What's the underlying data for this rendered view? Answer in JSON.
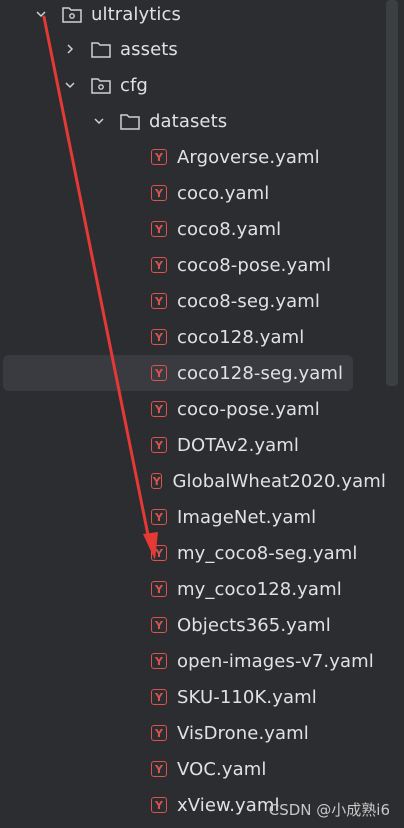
{
  "tree": {
    "root": {
      "label": "ultralytics",
      "expanded": true
    },
    "assets": {
      "label": "assets",
      "expanded": false
    },
    "cfg": {
      "label": "cfg",
      "expanded": true
    },
    "datasets": {
      "label": "datasets",
      "expanded": true
    },
    "files": [
      "Argoverse.yaml",
      "coco.yaml",
      "coco8.yaml",
      "coco8-pose.yaml",
      "coco8-seg.yaml",
      "coco128.yaml",
      "coco128-seg.yaml",
      "coco-pose.yaml",
      "DOTAv2.yaml",
      "GlobalWheat2020.yaml",
      "ImageNet.yaml",
      "my_coco8-seg.yaml",
      "my_coco128.yaml",
      "Objects365.yaml",
      "open-images-v7.yaml",
      "SKU-110K.yaml",
      "VisDrone.yaml",
      "VOC.yaml",
      "xView.yaml"
    ],
    "selected_file": "coco128-seg.yaml",
    "yaml_icon_glyph": "Y"
  },
  "watermark": "CSDN @小成熟i6",
  "colors": {
    "background": "#2b2d30",
    "selection": "#393b40",
    "text": "#dfe1e5",
    "yaml_icon": "#d9534f",
    "annotation_arrow": "#e53935"
  }
}
